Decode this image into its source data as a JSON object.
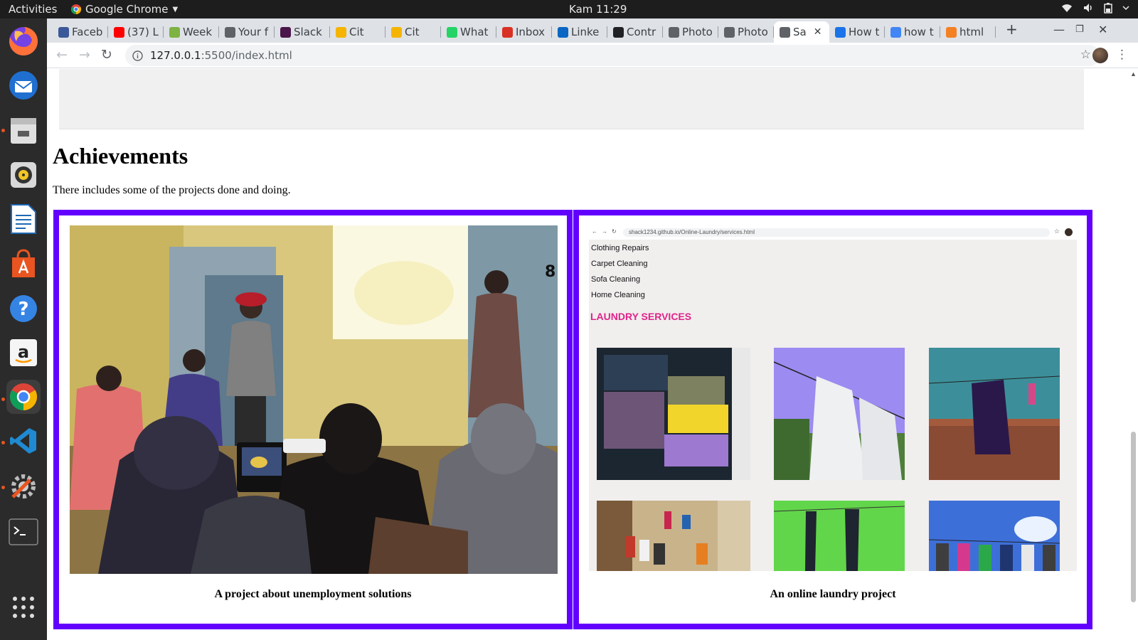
{
  "topbar": {
    "activities": "Activities",
    "app_name": "Google Chrome",
    "clock": "Kam 11:29",
    "tray_icons": [
      "wifi-icon",
      "volume-icon",
      "battery-icon",
      "power-menu-icon"
    ]
  },
  "dock": {
    "items": [
      "firefox",
      "thunderbird",
      "files",
      "rhythmbox",
      "libreoffice-writer",
      "software-center",
      "help",
      "amazon",
      "chrome",
      "vscode",
      "system-tools",
      "terminal",
      "show-applications"
    ]
  },
  "browser": {
    "tabs": [
      {
        "label": "Faceb",
        "icon": "facebook-icon",
        "color": "#3b5998"
      },
      {
        "label": "(37) L",
        "icon": "youtube-icon",
        "color": "#ff0000"
      },
      {
        "label": "Week",
        "icon": "leaf-icon",
        "color": "#7cb342"
      },
      {
        "label": "Your f",
        "icon": "globe-icon",
        "color": "#5f6368"
      },
      {
        "label": "Slack",
        "icon": "slack-icon",
        "color": "#4a154b"
      },
      {
        "label": "Cit",
        "icon": "emoji-icon",
        "color": "#f4b400"
      },
      {
        "label": "Cit",
        "icon": "emoji-icon",
        "color": "#f4b400"
      },
      {
        "label": "What",
        "icon": "whatsapp-icon",
        "color": "#25d366"
      },
      {
        "label": "Inbox",
        "icon": "gmail-icon",
        "color": "#d93025"
      },
      {
        "label": "Linke",
        "icon": "linkedin-icon",
        "color": "#0a66c2"
      },
      {
        "label": "Contr",
        "icon": "github-icon",
        "color": "#202124"
      },
      {
        "label": "Photo",
        "icon": "aperture-icon",
        "color": "#5f6368"
      },
      {
        "label": "Photo",
        "icon": "aperture-icon",
        "color": "#5f6368"
      },
      {
        "label": "Sa",
        "icon": "globe-icon",
        "color": "#5f6368",
        "active": true
      },
      {
        "label": "How t",
        "icon": "upwork-icon",
        "color": "#1a73e8"
      },
      {
        "label": "how t",
        "icon": "google-icon",
        "color": "#4285f4"
      },
      {
        "label": "html",
        "icon": "stackoverflow-icon",
        "color": "#f48024"
      }
    ],
    "new_tab_symbol": "+",
    "close_symbol": "✕",
    "address": {
      "host": "127.0.0.1",
      "path": ":5500/index.html"
    }
  },
  "page": {
    "heading": "Achievements",
    "intro": "There includes some of the projects done and doing.",
    "cards": [
      {
        "caption": "A project about unemployment solutions"
      },
      {
        "caption": "An online laundry project"
      }
    ],
    "laundry_screenshot": {
      "url": "shack1234.github.io/Online-Laundry/services.html",
      "menu": [
        "Clothing Repairs",
        "Carpet Cleaning",
        "Sofa Cleaning",
        "Home Cleaning"
      ],
      "section_title": "LAUNDRY SERVICES",
      "accent": "#e0248a"
    },
    "card_border_color": "#6200ff"
  }
}
